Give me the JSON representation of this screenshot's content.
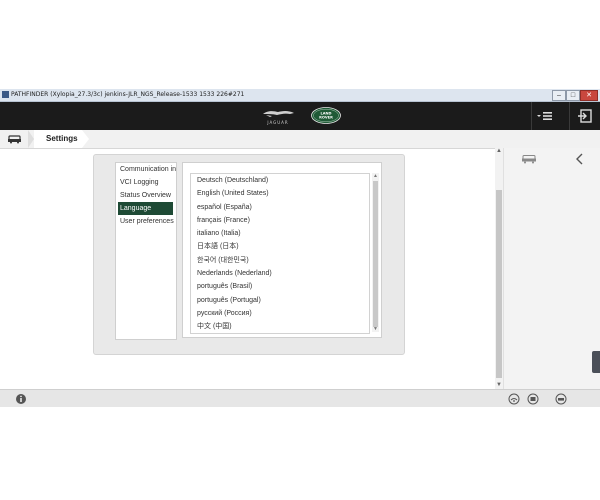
{
  "window": {
    "title": "PATHFINDER (Xylopia_27.3/3c) jenkins-JLR_NGS_Release-1533 1533 226#271",
    "controls": [
      "–",
      "□",
      "✕"
    ]
  },
  "header": {
    "brand_left": "JAGUAR",
    "brand_right_line1": "LAND",
    "brand_right_line2": "ROVER"
  },
  "breadcrumb": {
    "current": "Settings"
  },
  "settings": {
    "nav": [
      {
        "label": "Communication in",
        "selected": false
      },
      {
        "label": "VCI Logging",
        "selected": false
      },
      {
        "label": "Status Overview",
        "selected": false
      },
      {
        "label": "Language",
        "selected": true
      },
      {
        "label": "User preferences",
        "selected": false
      }
    ],
    "languages": [
      "Deutsch (Deutschland)",
      "English (United States)",
      "español (España)",
      "français (France)",
      "italiano (Italia)",
      "日本語 (日本)",
      "한국어 (대한민국)",
      "Nederlands (Nederland)",
      "português (Brasil)",
      "português (Portugal)",
      "русский (Россия)",
      "中文 (中国)"
    ]
  },
  "colors": {
    "topbar": "#1b1b1b",
    "accent_selected": "#1e4a35",
    "land_rover_green": "#1f5a36"
  },
  "icons": [
    "vehicle-icon",
    "menu-icon",
    "exit-icon",
    "back-chevron-icon",
    "info-icon"
  ]
}
